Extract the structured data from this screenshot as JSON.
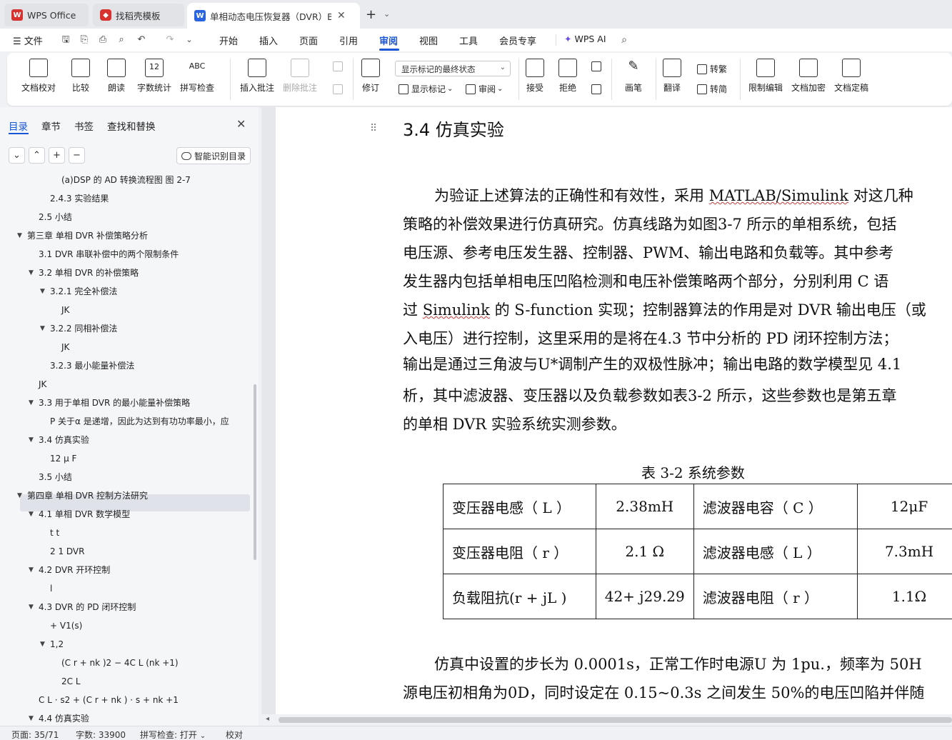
{
  "tabs": [
    {
      "label": "WPS Office",
      "icon": "wps-logo-icon"
    },
    {
      "label": "找稻壳模板",
      "icon": "docer-icon"
    },
    {
      "label": "单相动态电压恢复器（DVR）B",
      "icon": "word-doc-icon"
    }
  ],
  "menu": {
    "file": "文件",
    "items": [
      "开始",
      "插入",
      "页面",
      "引用",
      "审阅",
      "视图",
      "工具",
      "会员专享"
    ],
    "active": "审阅",
    "ai": "WPS AI"
  },
  "ribbon": {
    "proofread": "文档校对",
    "compare": "比较",
    "read_aloud": "朗读",
    "word_count": "字数统计",
    "spell_check": "拼写检查",
    "insert_comment": "插入批注",
    "delete_comment": "删除批注",
    "revise": "修订",
    "markup_select": "显示标记的最终状态",
    "show_markup": "显示标记",
    "review": "审阅",
    "accept": "接受",
    "reject": "拒绝",
    "pen": "画笔",
    "translate": "翻译",
    "to_traditional": "转繁",
    "to_simplified": "转简",
    "restrict_edit": "限制编辑",
    "encrypt": "文档加密",
    "finalize": "文档定稿"
  },
  "sidebar": {
    "tabs": [
      "目录",
      "章节",
      "书签",
      "查找和替换"
    ],
    "smart_toc": "智能识别目录",
    "toc": [
      {
        "text": "(a)DSP 的 AD 转换流程图  图 2-7",
        "level": 4,
        "tri": ""
      },
      {
        "text": "2.4.3 实验结果",
        "level": 3,
        "tri": ""
      },
      {
        "text": "2.5 小结",
        "level": 2,
        "tri": ""
      },
      {
        "text": "第三章  单相 DVR 补偿策略分析",
        "level": 1,
        "tri": "▼"
      },
      {
        "text": "3.1 DVR 串联补偿中的两个限制条件",
        "level": 2,
        "tri": ""
      },
      {
        "text": "3.2 单相 DVR 的补偿策略",
        "level": 2,
        "tri": "▼"
      },
      {
        "text": "3.2.1 完全补偿法",
        "level": 3,
        "tri": "▼"
      },
      {
        "text": "JK",
        "level": 4,
        "tri": ""
      },
      {
        "text": "3.2.2 同相补偿法",
        "level": 3,
        "tri": "▼"
      },
      {
        "text": "JK",
        "level": 4,
        "tri": ""
      },
      {
        "text": "3.2.3 最小能量补偿法",
        "level": 3,
        "tri": ""
      },
      {
        "text": "JK",
        "level": 0,
        "tri": ""
      },
      {
        "text": "3.3 用于单相 DVR 的最小能量补偿策略",
        "level": 2,
        "tri": "▼"
      },
      {
        "text": "P    关于α 是递增，因此为达到有功功率最小，应",
        "level": 3,
        "tri": ""
      },
      {
        "text": "3.4 仿真实验",
        "level": 2,
        "tri": "▼"
      },
      {
        "text": "12 μ F",
        "level": 3,
        "tri": ""
      },
      {
        "text": "3.5 小结",
        "level": 2,
        "tri": ""
      },
      {
        "text": "第四章  单相 DVR 控制方法研究",
        "level": 1,
        "tri": "▼"
      },
      {
        "text": "4.1 单相 DVR 数学模型",
        "level": 2,
        "tri": "▼"
      },
      {
        "text": "t      t",
        "level": 3,
        "tri": ""
      },
      {
        "text": "2          1          DVR",
        "level": 3,
        "tri": ""
      },
      {
        "text": "4.2 DVR 开环控制",
        "level": 2,
        "tri": "▼"
      },
      {
        "text": "l",
        "level": 3,
        "tri": ""
      },
      {
        "text": "4.3 DVR 的 PD 闭环控制",
        "level": 2,
        "tri": "▼"
      },
      {
        "text": "+    V1(s)",
        "level": 3,
        "tri": ""
      },
      {
        "text": "1,2",
        "level": 3,
        "tri": "▼"
      },
      {
        "text": "(C r  + nk )2 − 4C L (nk  +1)",
        "level": 4,
        "tri": ""
      },
      {
        "text": "2C L",
        "level": 4,
        "tri": ""
      },
      {
        "text": "C L  · s2 + (C r  + nk ) · s + nk  +1",
        "level": 2,
        "tri": ""
      },
      {
        "text": "4.4 仿真实验",
        "level": 2,
        "tri": "▼"
      }
    ]
  },
  "document": {
    "heading": "3.4 仿真实验",
    "p1": [
      [
        "为验证上述算法的正确性和有效性，采用  ",
        "MATLAB/Simulink",
        " 对这几种"
      ],
      [
        "策略的补偿效果进行仿真研究。仿真线路为如图3-7 所示的单相系统，包括"
      ],
      [
        "电压源、参考电压发生器、控制器、PWM、输出电路和负载等。其中参考"
      ],
      [
        "发生器内包括单相电压凹陷检测和电压补偿策略两个部分，分别利用  C 语"
      ],
      [
        "过  ",
        "Simulink",
        " 的  S-function 实现；控制器算法的作用是对  DVR 输出电压（或"
      ],
      [
        "入电压）进行控制，这里采用的是将在4.3 节中分析的  PD 闭环控制方法；"
      ],
      [
        "输出是通过三角波与U*调制产生的双极性脉冲；输出电路的数学模型见  4.1"
      ],
      [
        "析，其中滤波器、变压器以及负载参数如表3-2 所示，这些参数也是第五章"
      ],
      [
        "的单相  DVR 实验系统实测参数。"
      ]
    ],
    "table_title": "表 3-2 系统参数",
    "table": [
      [
        "变压器电感（ L ）",
        "2.38mH",
        "滤波器电容（ C  ）",
        "12μF"
      ],
      [
        "变压器电阻（ r ）",
        "2.1 Ω",
        "滤波器电感（ L  ）",
        "7.3mH"
      ],
      [
        "负载阻抗(r + jL )",
        "42+ j29.29",
        "滤波器电阻（ r  ）",
        "1.1Ω"
      ]
    ],
    "p2": [
      "仿真中设置的步长为  0.0001s，正常工作时电源U  为  1pu.，频率为  50H",
      "源电压初相角为0D，同时设定在 0.15~0.3s 之间发生 50%的电压凹陷并伴随"
    ]
  },
  "status": {
    "page": "页面: 35/71",
    "words": "字数: 33900",
    "spell": "拼写检查: 打开",
    "proof": "校对"
  },
  "colors": {
    "accent": "#1a56d8",
    "wps_red": "#d8322f"
  }
}
